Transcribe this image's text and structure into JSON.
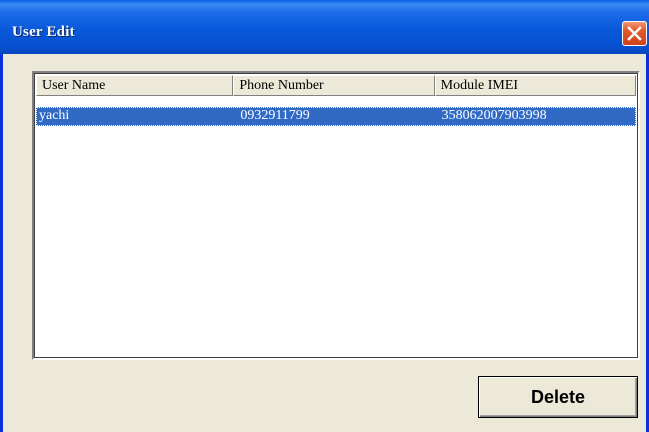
{
  "window": {
    "title": "User Edit",
    "close_icon": "close-icon"
  },
  "colors": {
    "titlebar": "#0A5FE4",
    "window_bg": "#ECE9D8",
    "selection": "#316AC5",
    "close_button": "#E35A2E"
  },
  "table": {
    "columns": [
      "User Name",
      "Phone Number",
      "Module IMEI"
    ],
    "rows": [
      {
        "user_name": "yachi",
        "phone_number": "0932911799",
        "module_imei": "358062007903998",
        "selected": true
      }
    ]
  },
  "buttons": {
    "delete_label": "Delete"
  }
}
